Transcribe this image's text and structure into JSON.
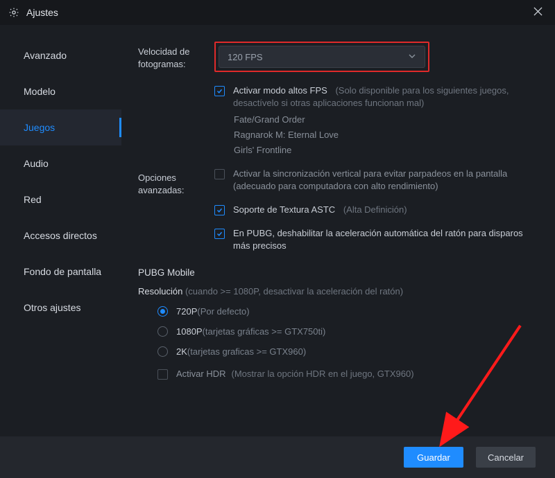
{
  "window": {
    "title": "Ajustes"
  },
  "sidebar": {
    "items": [
      {
        "label": "Avanzado"
      },
      {
        "label": "Modelo"
      },
      {
        "label": "Juegos"
      },
      {
        "label": "Audio"
      },
      {
        "label": "Red"
      },
      {
        "label": "Accesos directos"
      },
      {
        "label": "Fondo de pantalla"
      },
      {
        "label": "Otros ajustes"
      }
    ],
    "active_index": 2
  },
  "fps": {
    "label": "Velocidad de fotogramas:",
    "value": "120 FPS",
    "highfps": {
      "label": "Activar modo altos FPS",
      "hint": "(Solo disponible para los siguientes juegos, desactívelo si otras aplicaciones funcionan mal)",
      "checked": true,
      "games": [
        "Fate/Grand Order",
        "Ragnarok M: Eternal Love",
        "Girls' Frontline"
      ]
    }
  },
  "advanced": {
    "label": "Opciones avanzadas:",
    "vsync": {
      "label": "Activar la sincronización vertical para evitar parpadeos en la pantalla (adecuado para computadora con alto rendimiento)",
      "checked": false
    },
    "astc": {
      "label": "Soporte de Textura ASTC",
      "hint": "(Alta Definición)",
      "checked": true
    },
    "pubg_mouse": {
      "label": "En PUBG, deshabilitar la aceleración automática del ratón para disparos más precisos",
      "checked": true
    }
  },
  "pubg": {
    "title": "PUBG Mobile",
    "resolution_label": "Resolución",
    "resolution_hint": "(cuando >= 1080P, desactivar la aceleración del ratón)",
    "options": [
      {
        "label": "720P",
        "hint": "(Por defecto)",
        "checked": true
      },
      {
        "label": "1080P",
        "hint": "(tarjetas gráficas >= GTX750ti)",
        "checked": false
      },
      {
        "label": "2K",
        "hint": "(tarjetas graficas >= GTX960)",
        "checked": false
      }
    ],
    "hdr": {
      "label": "Activar HDR",
      "hint": "(Mostrar la opción HDR en el juego, GTX960)",
      "checked": false
    }
  },
  "footer": {
    "save": "Guardar",
    "cancel": "Cancelar"
  }
}
